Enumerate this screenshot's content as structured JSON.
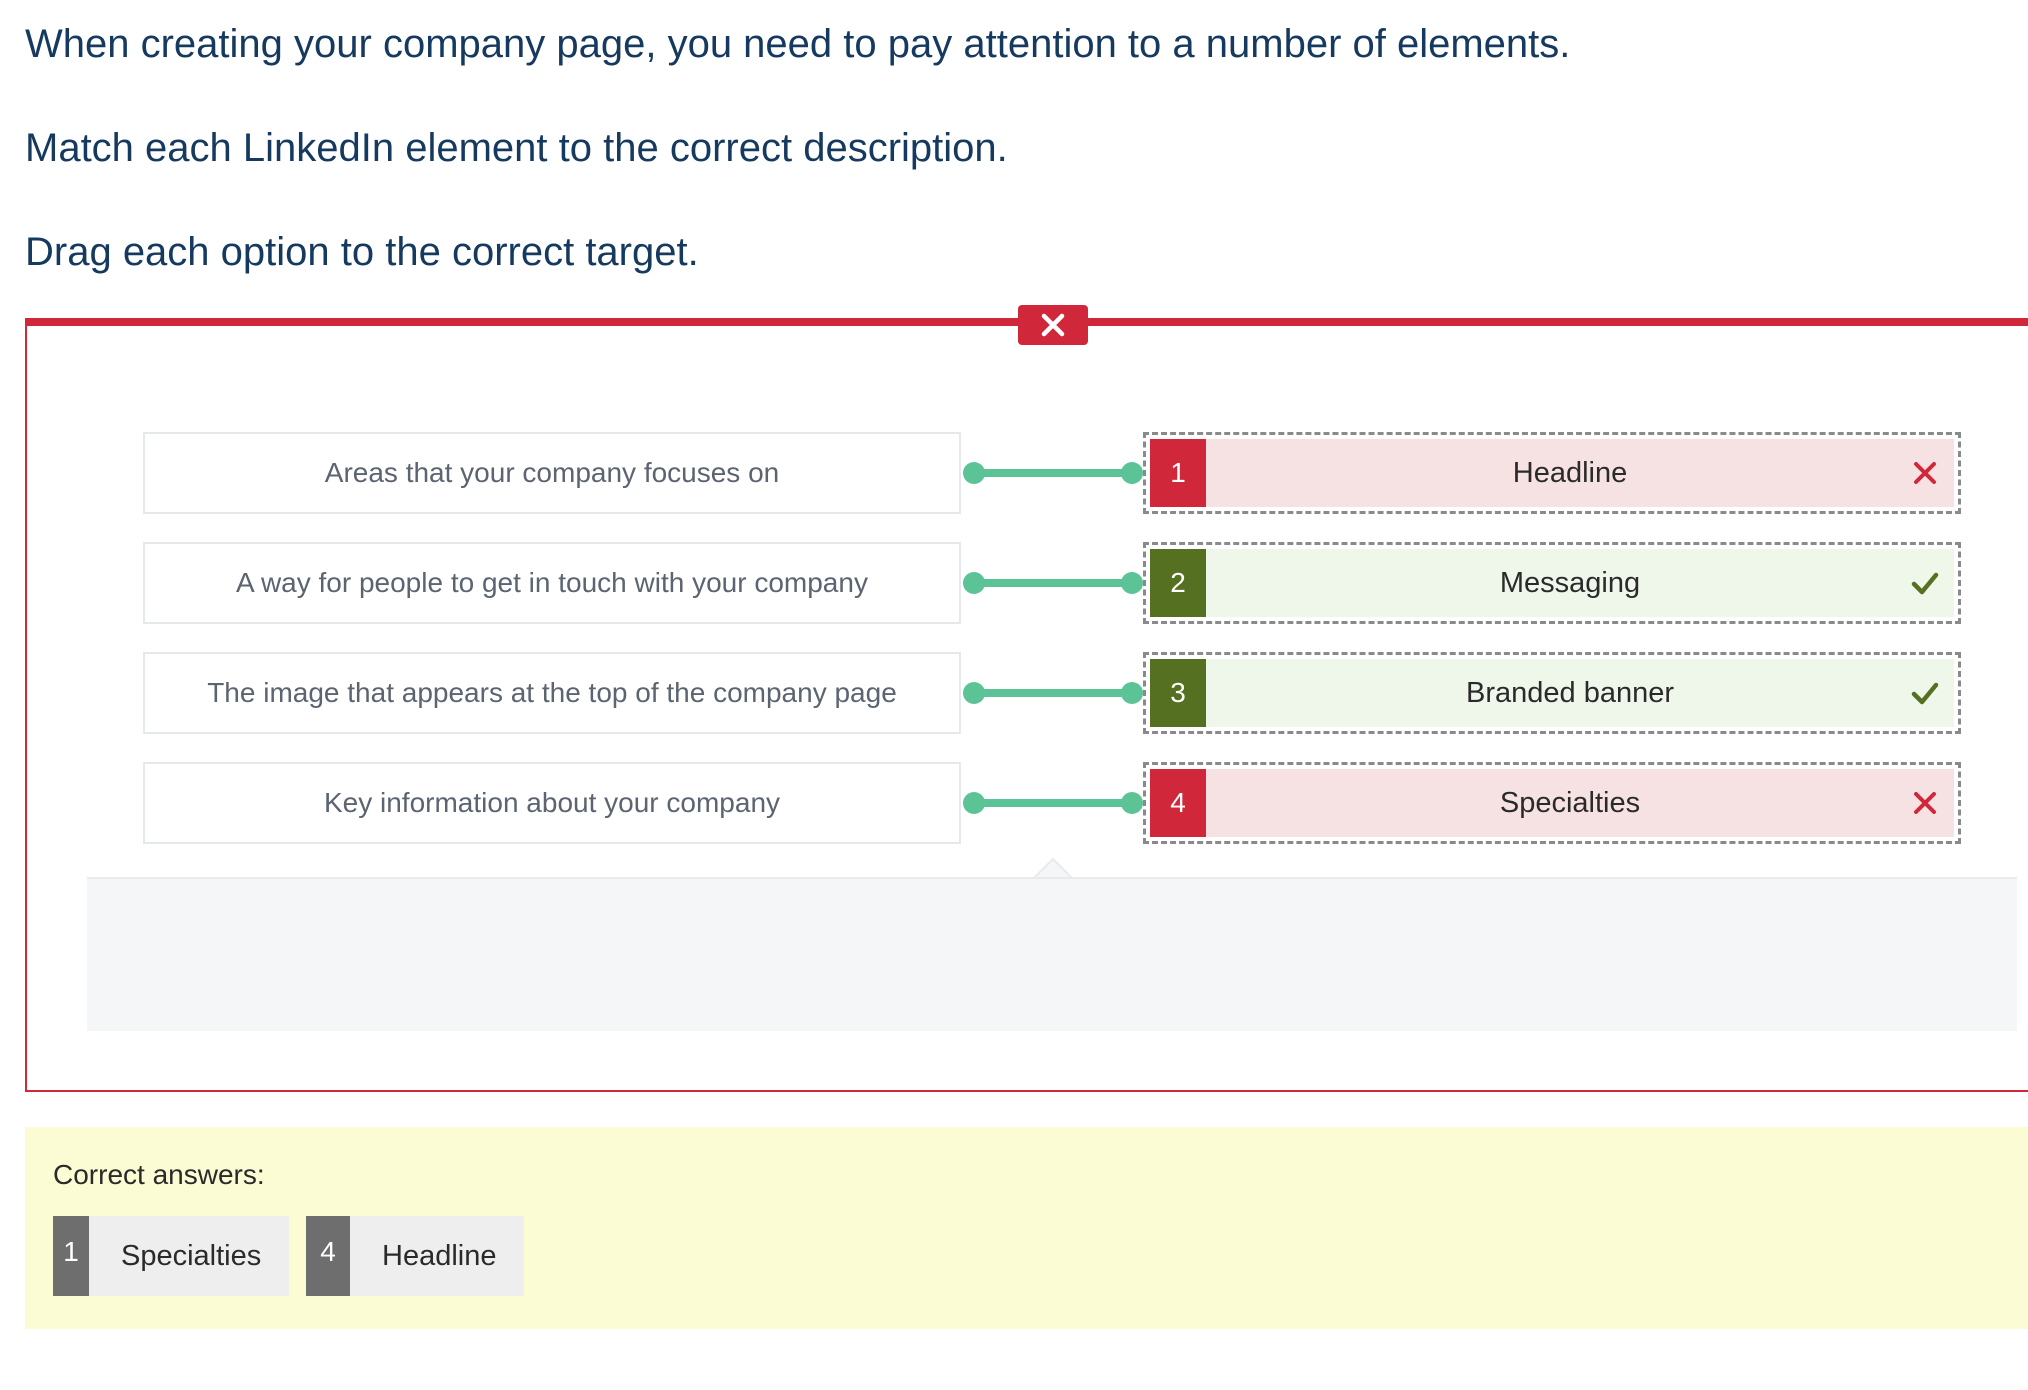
{
  "instructions": {
    "line1": "When creating your company page, you need to pay attention to a number of elements.",
    "line2": "Match each LinkedIn element to the correct description.",
    "line3": "Drag each option to the correct target."
  },
  "quiz": {
    "result_icon": "close-icon",
    "accent_color": "#d0283a",
    "correct_color": "#557020",
    "connector_color": "#5cc397",
    "items": [
      {
        "description": "Areas that your company focuses on",
        "number": "1",
        "answer": "Headline",
        "status": "wrong",
        "status_icon": "cross-icon"
      },
      {
        "description": "A way for people to get in touch with your company",
        "number": "2",
        "answer": "Messaging",
        "status": "correct",
        "status_icon": "check-icon"
      },
      {
        "description": "The image that appears at the top of the company page",
        "number": "3",
        "answer": "Branded banner",
        "status": "correct",
        "status_icon": "check-icon"
      },
      {
        "description": "Key information about your company",
        "number": "4",
        "answer": "Specialties",
        "status": "wrong",
        "status_icon": "cross-icon"
      }
    ]
  },
  "correct_answers": {
    "title": "Correct answers:",
    "items": [
      {
        "number": "1",
        "label": "Specialties"
      },
      {
        "number": "4",
        "label": "Headline"
      }
    ]
  }
}
